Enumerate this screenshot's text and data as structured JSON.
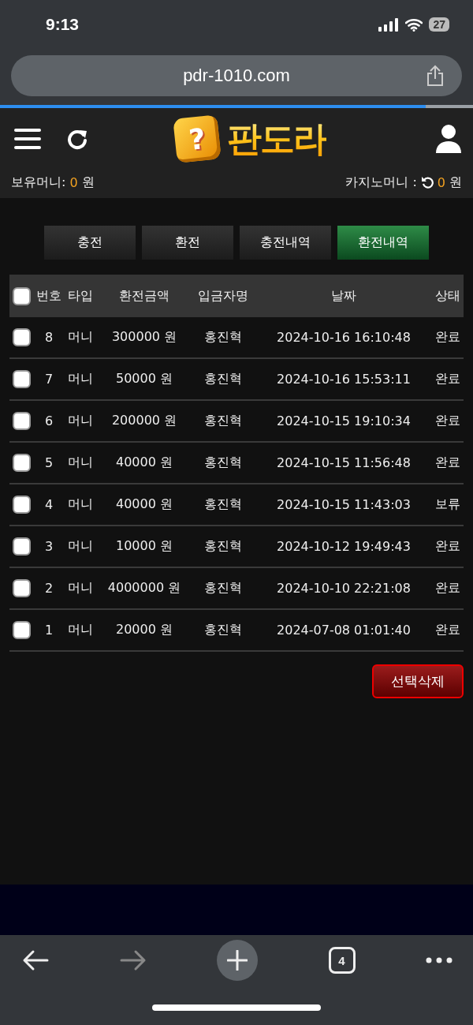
{
  "status_bar": {
    "time": "9:13",
    "battery": "27"
  },
  "browser": {
    "url": "pdr-1010.com",
    "progress": {
      "level": 0.9
    }
  },
  "header": {
    "logo_mark": "?",
    "logo_text": "판도라"
  },
  "wallet": {
    "balance_label": "보유머니:",
    "balance_value": "0",
    "balance_unit": "원",
    "casino_label": "카지노머니 :",
    "casino_value": "0",
    "casino_unit": "원"
  },
  "tabs": [
    {
      "label": "충전",
      "selected": false
    },
    {
      "label": "환전",
      "selected": false
    },
    {
      "label": "충전내역",
      "selected": false
    },
    {
      "label": "환전내역",
      "selected": true
    }
  ],
  "table": {
    "select_all_checked": false,
    "columns": [
      "번호",
      "타입",
      "환전금액",
      "입금자명",
      "날짜",
      "상태"
    ],
    "rows": [
      {
        "checked": false,
        "cells": [
          "8",
          "머니",
          "300000 원",
          "홍진혁",
          "2024-10-16 16:10:48",
          "완료"
        ]
      },
      {
        "checked": false,
        "cells": [
          "7",
          "머니",
          "50000 원",
          "홍진혁",
          "2024-10-16 15:53:11",
          "완료"
        ]
      },
      {
        "checked": false,
        "cells": [
          "6",
          "머니",
          "200000 원",
          "홍진혁",
          "2024-10-15 19:10:34",
          "완료"
        ]
      },
      {
        "checked": false,
        "cells": [
          "5",
          "머니",
          "40000 원",
          "홍진혁",
          "2024-10-15 11:56:48",
          "완료"
        ]
      },
      {
        "checked": false,
        "cells": [
          "4",
          "머니",
          "40000 원",
          "홍진혁",
          "2024-10-15 11:43:03",
          "보류"
        ]
      },
      {
        "checked": false,
        "cells": [
          "3",
          "머니",
          "10000 원",
          "홍진혁",
          "2024-10-12 19:49:43",
          "완료"
        ]
      },
      {
        "checked": false,
        "cells": [
          "2",
          "머니",
          "4000000 원",
          "홍진혁",
          "2024-10-10 22:21:08",
          "완료"
        ]
      },
      {
        "checked": false,
        "cells": [
          "1",
          "머니",
          "20000 원",
          "홍진혁",
          "2024-07-08 01:01:40",
          "완료"
        ]
      }
    ]
  },
  "delete_button": "선택삭제",
  "toolbar": {
    "tab_count": "4",
    "forward_disabled": true
  }
}
